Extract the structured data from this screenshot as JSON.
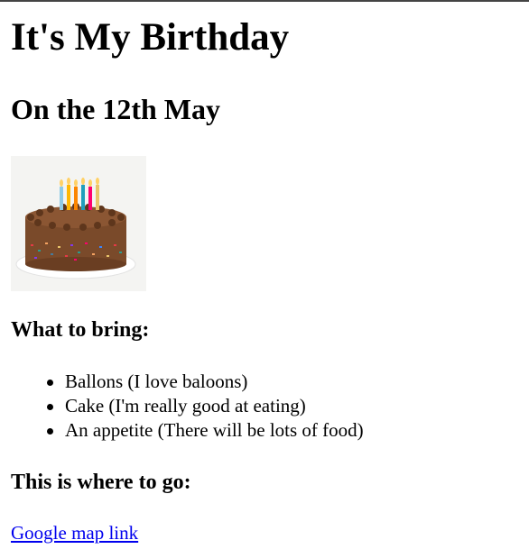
{
  "page": {
    "title": "It's My Birthday",
    "date_heading": "On the 12th May",
    "image_icon": "birthday-cake-photo"
  },
  "bring": {
    "heading": "What to bring:",
    "items": [
      "Ballons (I love baloons)",
      "Cake (I'm really good at eating)",
      "An appetite (There will be lots of food)"
    ]
  },
  "location": {
    "heading": "This is where to go:",
    "link_text": "Google map link"
  },
  "colors": {
    "link": "#0000ee",
    "text": "#000000",
    "cake": "#7a4a2a"
  }
}
